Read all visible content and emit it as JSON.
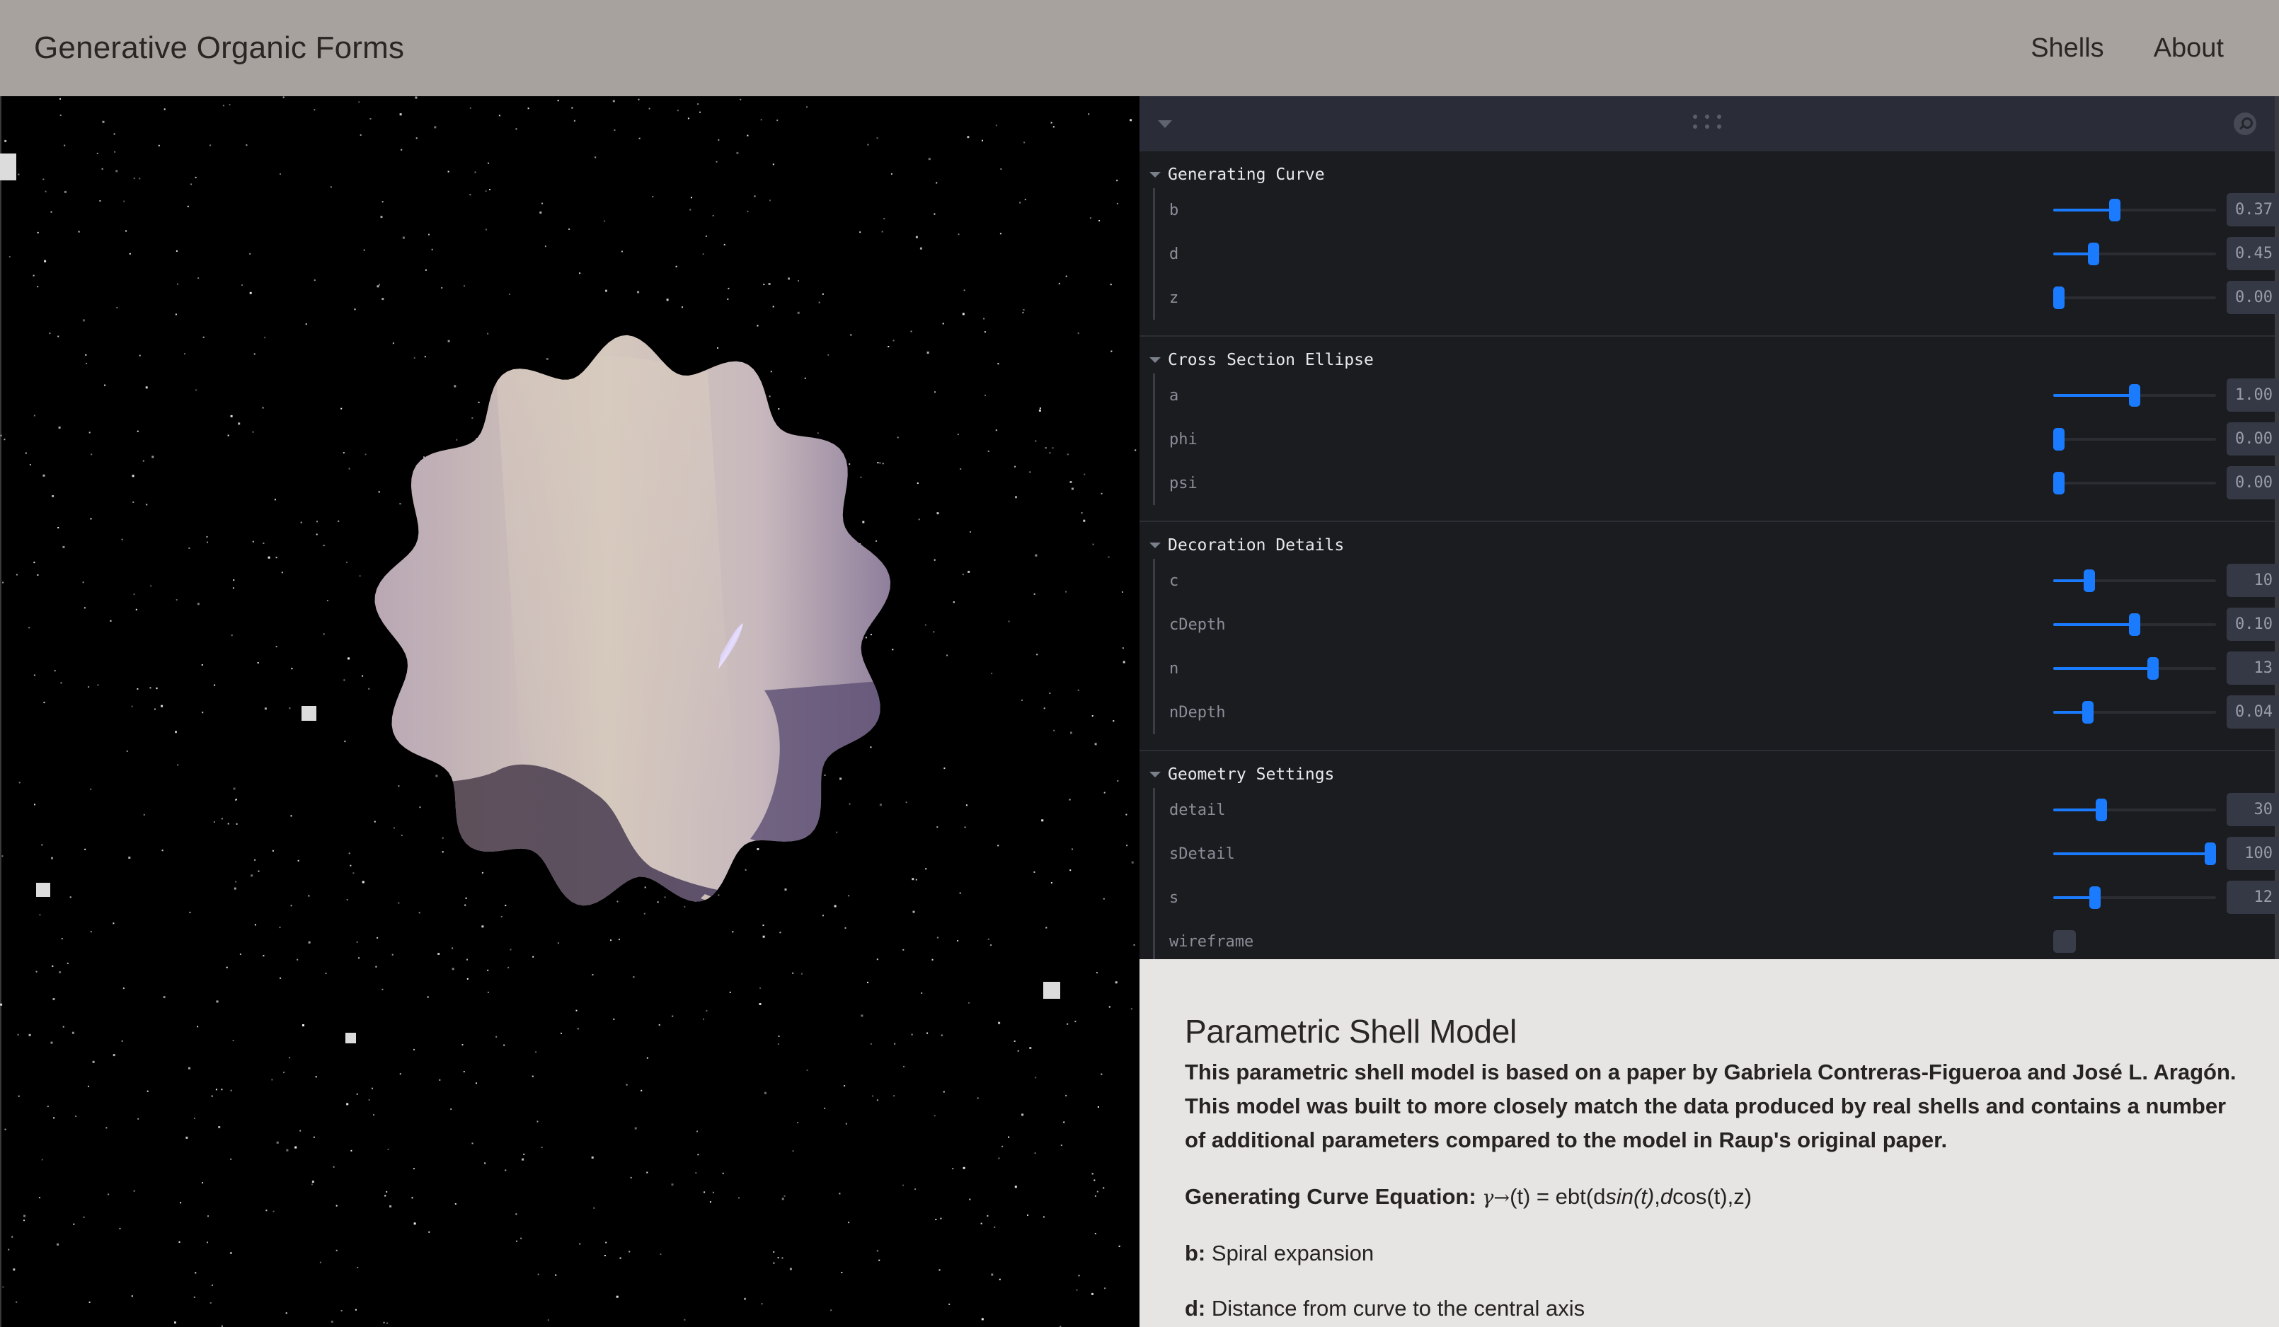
{
  "header": {
    "title": "Generative Organic Forms",
    "nav": [
      {
        "label": "Shells"
      },
      {
        "label": "About"
      }
    ]
  },
  "viewport": {
    "description": "3D rendered parametric shell on starfield background",
    "shell_colors": {
      "light": "#d6c8bd",
      "mid": "#b3a3b4",
      "shadow": "#5e5058",
      "purple": "#625478"
    }
  },
  "panel": {
    "collapse_icon": "triangle-down-icon",
    "drag_icon": "drag-handle-icon",
    "search_icon": "search-icon",
    "accent_color": "#1a7bff",
    "folders": [
      {
        "title": "Generating Curve",
        "params": [
          {
            "name": "b",
            "value": "0.37",
            "fraction": 0.37
          },
          {
            "name": "d",
            "value": "0.45",
            "fraction": 0.23
          },
          {
            "name": "z",
            "value": "0.00",
            "fraction": 0.0
          }
        ]
      },
      {
        "title": "Cross Section Ellipse",
        "params": [
          {
            "name": "a",
            "value": "1.00",
            "fraction": 0.5
          },
          {
            "name": "phi",
            "value": "0.00",
            "fraction": 0.0
          },
          {
            "name": "psi",
            "value": "0.00",
            "fraction": 0.0
          }
        ]
      },
      {
        "title": "Decoration Details",
        "params": [
          {
            "name": "c",
            "value": "10",
            "fraction": 0.2
          },
          {
            "name": "cDepth",
            "value": "0.10",
            "fraction": 0.5
          },
          {
            "name": "n",
            "value": "13",
            "fraction": 0.62
          },
          {
            "name": "nDepth",
            "value": "0.04",
            "fraction": 0.19
          }
        ]
      },
      {
        "title": "Geometry Settings",
        "params": [
          {
            "name": "detail",
            "value": "30",
            "fraction": 0.28
          },
          {
            "name": "sDetail",
            "value": "100",
            "fraction": 1.0
          },
          {
            "name": "s",
            "value": "12",
            "fraction": 0.24
          },
          {
            "name": "wireframe",
            "type": "checkbox",
            "checked": false
          }
        ]
      }
    ]
  },
  "description": {
    "heading": "Parametric Shell Model",
    "intro": "This parametric shell model is based on a paper by Gabriela Contreras-Figueroa and José L. Aragón. This model was built to more closely match the data produced by real shells and contains a number of additional parameters compared to the model in Raup's original paper.",
    "equation_label": "Generating Curve Equation:",
    "equation": {
      "gamma": "γ→",
      "p1": "(t) = ebt(d",
      "sin": "sin(t)",
      "p2": ",",
      "d2": "d",
      "p3": "cos(t),z)"
    },
    "definitions": [
      {
        "term": "b:",
        "text": "Spiral expansion"
      },
      {
        "term": "d:",
        "text": "Distance from curve to the central axis"
      }
    ]
  }
}
